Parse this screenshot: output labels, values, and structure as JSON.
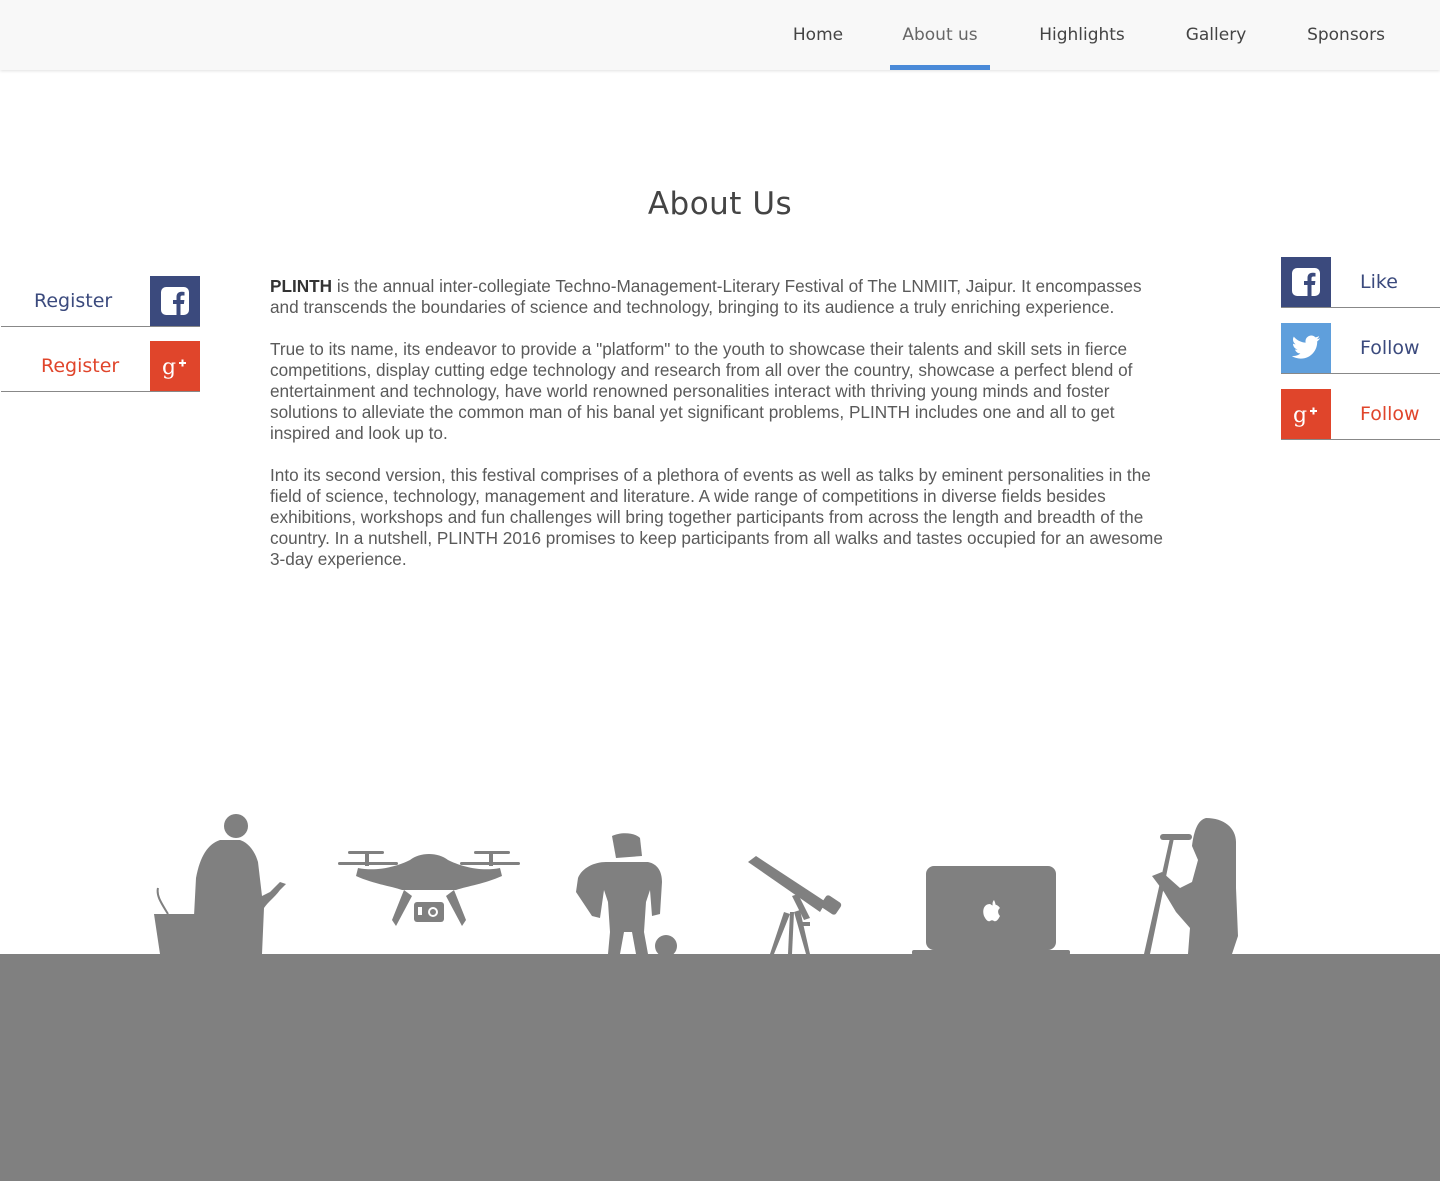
{
  "nav": {
    "items": [
      {
        "label": "Home",
        "active": false
      },
      {
        "label": "About us",
        "active": true
      },
      {
        "label": "Highlights",
        "active": false
      },
      {
        "label": "Gallery",
        "active": false
      },
      {
        "label": "Sponsors",
        "active": false
      }
    ],
    "active_color": "#4a8ad8"
  },
  "page": {
    "title": "About Us"
  },
  "about": {
    "p1_bold": "PLINTH",
    "p1_rest": " is the annual inter-collegiate Techno-Management-Literary Festival of The LNMIIT, Jaipur. It encompasses and transcends the boundaries of science and technology, bringing to its audience a truly enriching experience.",
    "p2": "True to its name, its endeavor to provide a \"platform\" to the youth to showcase their talents and skill sets in fierce competitions, display cutting edge technology and research from all over the country, showcase a perfect blend of entertainment and technology, have world renowned personalities interact with thriving young minds and foster solutions to alleviate the common man of his banal yet significant problems, PLINTH includes one and all to get inspired and look up to.",
    "p3": "Into its second version, this festival comprises of a plethora of events as well as talks by eminent personalities in the field of science, technology, management and literature. A wide range of competitions in diverse fields besides exhibitions, workshops and fun challenges will bring together participants from across the length and breadth of the country. In a nutshell, PLINTH 2016 promises to keep participants from all walks and tastes occupied for an awesome 3-day experience."
  },
  "left_social": {
    "facebook_register": {
      "label": "Register",
      "icon": "facebook-icon",
      "color": "#3b4a7d"
    },
    "googleplus_register": {
      "label": "Register",
      "icon": "google-plus-icon",
      "color": "#e0452b"
    }
  },
  "right_social": {
    "facebook_like": {
      "label": "Like",
      "icon": "facebook-icon",
      "color": "#3b4a7d"
    },
    "twitter_follow": {
      "label": "Follow",
      "icon": "twitter-icon",
      "color": "#5f9fdc"
    },
    "googleplus_follow": {
      "label": "Follow",
      "icon": "google-plus-icon",
      "color": "#e0452b"
    }
  },
  "footer": {
    "silhouettes": [
      "speaker-at-podium",
      "drone",
      "robot",
      "telescope",
      "laptop",
      "singer-with-microphone"
    ],
    "color": "#808080"
  }
}
